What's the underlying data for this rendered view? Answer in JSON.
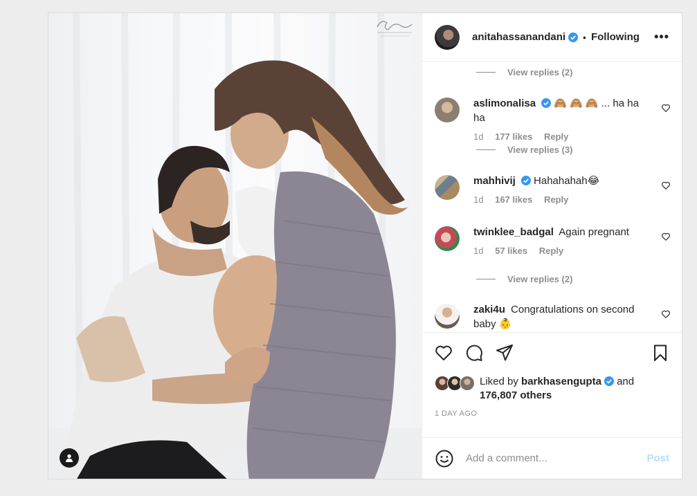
{
  "post": {
    "author": "anitahassanandani",
    "separator": "•",
    "follow_label": "Following",
    "more_label": "•••",
    "time_label": "1 DAY AGO"
  },
  "comments": [
    {
      "type": "replies",
      "label": "View replies (2)"
    },
    {
      "type": "comment",
      "user": "aslimonalisa",
      "verified": true,
      "text": "🙈 🙈 🙈 ... ha ha ha",
      "age": "1d",
      "likes": "177 likes",
      "reply": "Reply",
      "avatar_color": "#8a7f72"
    },
    {
      "type": "replies",
      "label": "View replies (3)"
    },
    {
      "type": "comment",
      "user": "mahhivij",
      "verified": true,
      "text": "Hahahahah😂",
      "age": "1d",
      "likes": "167 likes",
      "reply": "Reply",
      "avatar_color": "#9c8a6a"
    },
    {
      "type": "comment",
      "user": "twinklee_badgal",
      "verified": false,
      "text": "Again pregnant",
      "age": "1d",
      "likes": "57 likes",
      "reply": "Reply",
      "avatar_color": "#c44a5a"
    },
    {
      "type": "replies",
      "label": "View replies (2)"
    },
    {
      "type": "comment",
      "user": "zaki4u",
      "verified": false,
      "text": "Congratulations on second baby 👶",
      "age": "",
      "likes": "",
      "reply": "",
      "avatar_color": "#6d5a4a"
    }
  ],
  "likes": {
    "prefix": "Liked by",
    "user": "barkhasengupta",
    "suffix": "and",
    "count": "176,807 others"
  },
  "composer": {
    "placeholder": "Add a comment...",
    "post_label": "Post"
  },
  "colors": {
    "verified": "#3897f0",
    "post_disabled": "#b2dffc",
    "muted": "#8e8e8e"
  },
  "icons": {
    "like": "heart-icon",
    "comment": "comment-icon",
    "share": "send-icon",
    "save": "bookmark-icon",
    "emoji": "smiley-icon",
    "tag": "user-icon"
  }
}
